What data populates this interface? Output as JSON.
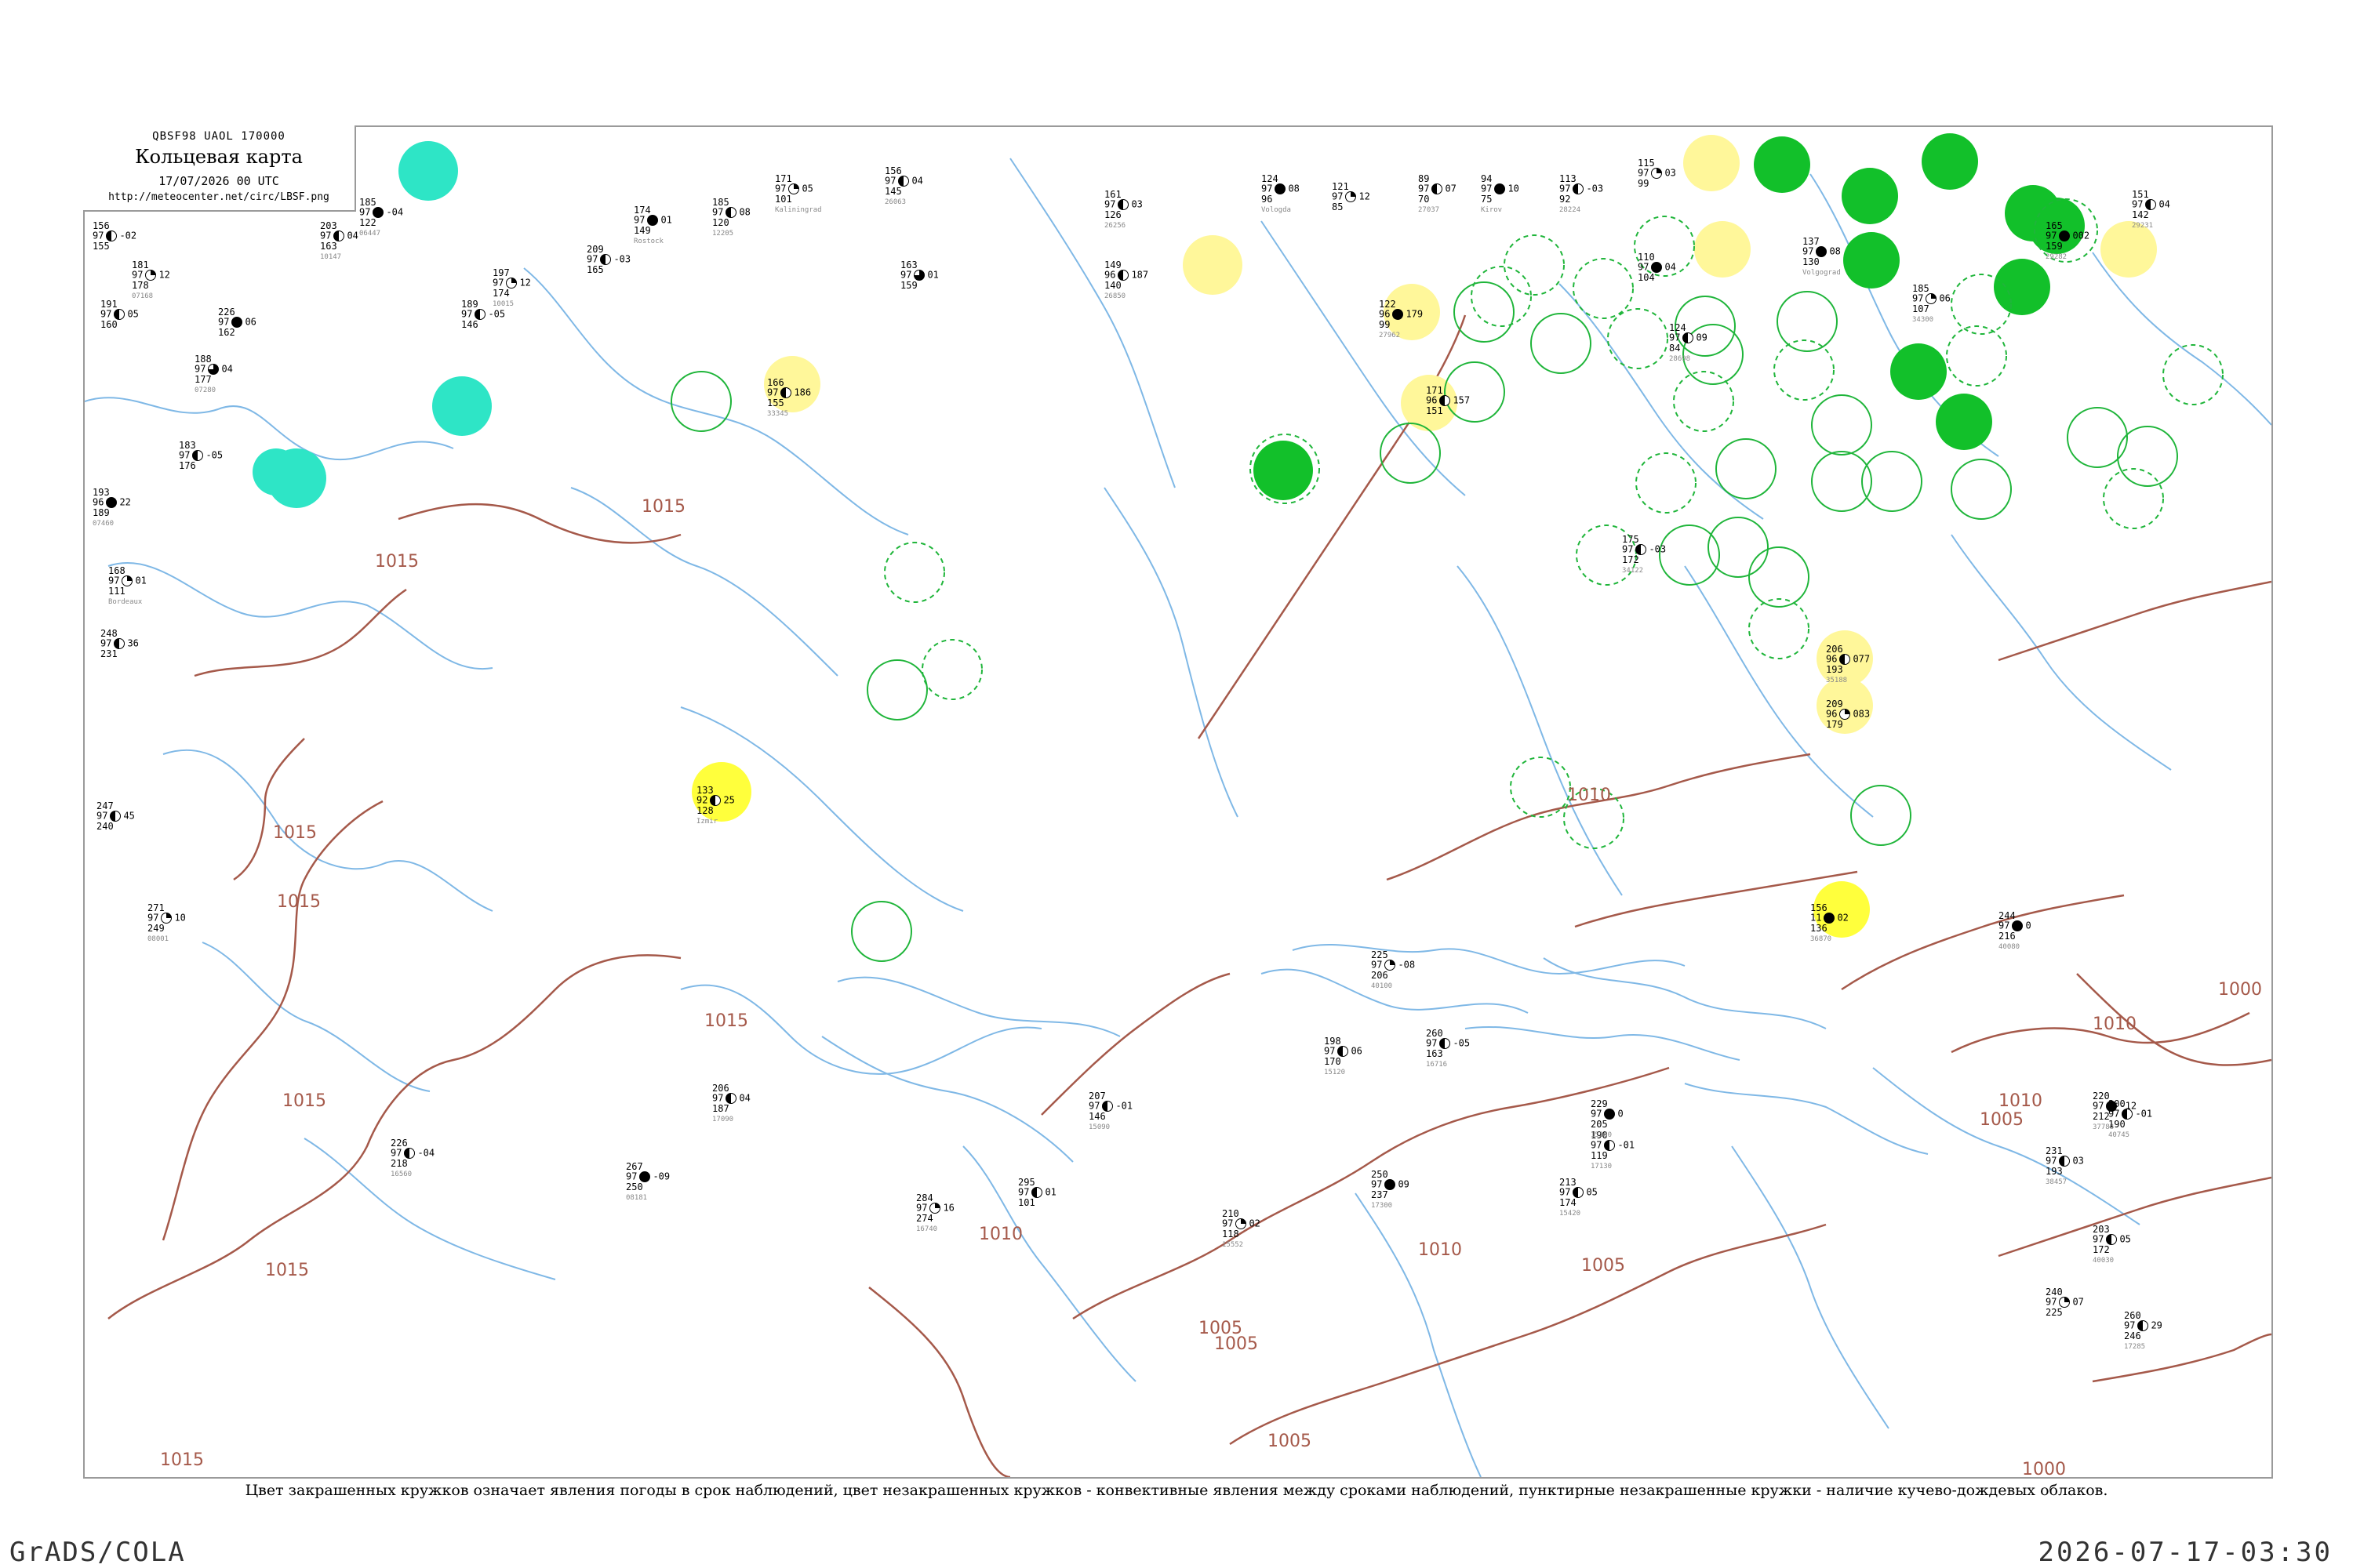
{
  "header": {
    "code": "QBSF98  UAOL  170000",
    "title": "Кольцевая карта",
    "date": "17/07/2026 00 UTC",
    "url": "http://meteocenter.net/circ/LBSF.png"
  },
  "legend_note": "Цвет закрашенных кружков означает явления погоды в срок наблюдений, цвет незакрашенных кружков - конвективные явления между сроками наблюдений, пунктирные незакрашенные кружки - наличие кучево-дождевых облаков.",
  "footer": {
    "left": "GrADS/COLA",
    "right": "2026-07-17-03:30"
  },
  "colors": {
    "isobar": "#a5594a",
    "river": "#7fb8e6",
    "cyan_marker": "#2ee5c6",
    "green_marker": "#12c02a",
    "yellow_marker": "#ffff3c",
    "pale_yellow_marker": "#fff79a",
    "green_ring": "#1fb53a",
    "frame": "#9a9a9a"
  },
  "isobar_labels": [
    "1015",
    "1015",
    "1015",
    "1015",
    "1015",
    "1015",
    "1015",
    "1015",
    "1010",
    "1010",
    "1010",
    "1010",
    "1010",
    "1005",
    "1005",
    "1005",
    "1005",
    "1005",
    "1000",
    "1000"
  ],
  "stations": [
    {
      "top": "156",
      "mid": "97",
      "bot": "155",
      "right": "-02",
      "cover": "half",
      "name": ""
    },
    {
      "top": "181",
      "mid": "97",
      "bot": "178",
      "right": "12",
      "cover": "q",
      "name": "07168"
    },
    {
      "top": "191",
      "mid": "97",
      "bot": "160",
      "right": "05",
      "cover": "half",
      "name": ""
    },
    {
      "top": "226",
      "mid": "97",
      "bot": "162",
      "right": "06",
      "cover": "full",
      "name": ""
    },
    {
      "top": "188",
      "mid": "97",
      "bot": "177",
      "right": "04",
      "cover": "tq",
      "name": "07280"
    },
    {
      "top": "183",
      "mid": "97",
      "bot": "176",
      "right": "-05",
      "cover": "half",
      "name": ""
    },
    {
      "top": "193",
      "mid": "96",
      "bot": "189",
      "right": "22",
      "cover": "full",
      "name": "07460"
    },
    {
      "top": "168",
      "mid": "97",
      "bot": "111",
      "right": "01",
      "cover": "q",
      "name": "Bordeaux"
    },
    {
      "top": "248",
      "mid": "97",
      "bot": "231",
      "right": "36",
      "cover": "half",
      "name": ""
    },
    {
      "top": "247",
      "mid": "97",
      "bot": "240",
      "right": "45",
      "cover": "half",
      "name": ""
    },
    {
      "top": "271",
      "mid": "97",
      "bot": "249",
      "right": "10",
      "cover": "q",
      "name": "08001"
    },
    {
      "top": "185",
      "mid": "97",
      "bot": "122",
      "right": "-04",
      "cover": "full",
      "name": "06447"
    },
    {
      "top": "203",
      "mid": "97",
      "bot": "163",
      "right": "04",
      "cover": "half",
      "name": "10147"
    },
    {
      "top": "189",
      "mid": "97",
      "bot": "146",
      "right": "-05",
      "cover": "half",
      "name": ""
    },
    {
      "top": "197",
      "mid": "97",
      "bot": "174",
      "right": "12",
      "cover": "q",
      "name": "10015"
    },
    {
      "top": "209",
      "mid": "97",
      "bot": "165",
      "right": "-03",
      "cover": "half",
      "name": ""
    },
    {
      "top": "174",
      "mid": "97",
      "bot": "149",
      "right": "01",
      "cover": "full",
      "name": "Rostock"
    },
    {
      "top": "185",
      "mid": "97",
      "bot": "120",
      "right": "08",
      "cover": "half",
      "name": "12205"
    },
    {
      "top": "171",
      "mid": "97",
      "bot": "101",
      "right": "05",
      "cover": "q",
      "name": "Kaliningrad"
    },
    {
      "top": "156",
      "mid": "97",
      "bot": "145",
      "right": "04",
      "cover": "half",
      "name": "26063"
    },
    {
      "top": "163",
      "mid": "97",
      "bot": "159",
      "right": "01",
      "cover": "tq",
      "name": ""
    },
    {
      "top": "161",
      "mid": "97",
      "bot": "126",
      "right": "03",
      "cover": "half",
      "name": "26256"
    },
    {
      "top": "124",
      "mid": "97",
      "bot": "96",
      "right": "08",
      "cover": "full",
      "name": "Vologda"
    },
    {
      "top": "121",
      "mid": "97",
      "bot": "85",
      "right": "12",
      "cover": "q",
      "name": ""
    },
    {
      "top": "89",
      "mid": "97",
      "bot": "70",
      "right": "07",
      "cover": "half",
      "name": "27037"
    },
    {
      "top": "94",
      "mid": "97",
      "bot": "75",
      "right": "10",
      "cover": "full",
      "name": "Kirov"
    },
    {
      "top": "113",
      "mid": "97",
      "bot": "92",
      "right": "-03",
      "cover": "half",
      "name": "28224"
    },
    {
      "top": "115",
      "mid": "97",
      "bot": "99",
      "right": "03",
      "cover": "q",
      "name": ""
    },
    {
      "top": "151",
      "mid": "97",
      "bot": "142",
      "right": "04",
      "cover": "half",
      "name": "29231"
    },
    {
      "top": "165",
      "mid": "97",
      "bot": "159",
      "right": "002",
      "cover": "full",
      "name": "29282"
    },
    {
      "top": "149",
      "mid": "96",
      "bot": "140",
      "right": "187",
      "cover": "half",
      "name": "26850"
    },
    {
      "top": "122",
      "mid": "96",
      "bot": "99",
      "right": "179",
      "cover": "full",
      "name": "27962"
    },
    {
      "top": "171",
      "mid": "96",
      "bot": "151",
      "right": "157",
      "cover": "half",
      "name": ""
    },
    {
      "top": "166",
      "mid": "97",
      "bot": "155",
      "right": "186",
      "cover": "half",
      "name": "33345"
    },
    {
      "top": "133",
      "mid": "92",
      "bot": "128",
      "right": "25",
      "cover": "half",
      "name": "Izmir"
    },
    {
      "top": "156",
      "mid": "11",
      "bot": "136",
      "right": "02",
      "cover": "full",
      "name": "36870"
    },
    {
      "top": "206",
      "mid": "96",
      "bot": "193",
      "right": "077",
      "cover": "half",
      "name": "35188"
    },
    {
      "top": "209",
      "mid": "96",
      "bot": "179",
      "right": "083",
      "cover": "q",
      "name": ""
    },
    {
      "top": "137",
      "mid": "97",
      "bot": "130",
      "right": "08",
      "cover": "full",
      "name": "Volgograd"
    },
    {
      "top": "175",
      "mid": "97",
      "bot": "172",
      "right": "-03",
      "cover": "half",
      "name": "34122"
    },
    {
      "top": "185",
      "mid": "97",
      "bot": "107",
      "right": "06",
      "cover": "q",
      "name": "34300"
    },
    {
      "top": "110",
      "mid": "97",
      "bot": "104",
      "right": "04",
      "cover": "full",
      "name": ""
    },
    {
      "top": "124",
      "mid": "97",
      "bot": "84",
      "right": "09",
      "cover": "half",
      "name": "28698"
    },
    {
      "top": "220",
      "mid": "97",
      "bot": "212",
      "right": "-12",
      "cover": "full",
      "name": "37788"
    },
    {
      "top": "231",
      "mid": "97",
      "bot": "193",
      "right": "03",
      "cover": "half",
      "name": "38457"
    },
    {
      "top": "200",
      "mid": "97",
      "bot": "190",
      "right": "-01",
      "cover": "half",
      "name": "40745"
    },
    {
      "top": "240",
      "mid": "97",
      "bot": "225",
      "right": "07",
      "cover": "q",
      "name": ""
    },
    {
      "top": "250",
      "mid": "97",
      "bot": "237",
      "right": "09",
      "cover": "full",
      "name": "17300"
    },
    {
      "top": "190",
      "mid": "97",
      "bot": "119",
      "right": "-01",
      "cover": "half",
      "name": "17130"
    },
    {
      "top": "260",
      "mid": "97",
      "bot": "163",
      "right": "-05",
      "cover": "half",
      "name": "16716"
    },
    {
      "top": "284",
      "mid": "97",
      "bot": "274",
      "right": "16",
      "cover": "q",
      "name": "16740"
    },
    {
      "top": "295",
      "mid": "97",
      "bot": "101",
      "right": "01",
      "cover": "half",
      "name": ""
    },
    {
      "top": "267",
      "mid": "97",
      "bot": "250",
      "right": "-09",
      "cover": "full",
      "name": "08181"
    },
    {
      "top": "226",
      "mid": "97",
      "bot": "218",
      "right": "-04",
      "cover": "half",
      "name": "16560"
    },
    {
      "top": "206",
      "mid": "97",
      "bot": "187",
      "right": "04",
      "cover": "half",
      "name": "17090"
    },
    {
      "top": "225",
      "mid": "97",
      "bot": "206",
      "right": "-08",
      "cover": "q",
      "name": "40100"
    },
    {
      "top": "244",
      "mid": "97",
      "bot": "216",
      "right": "0",
      "cover": "full",
      "name": "40080"
    },
    {
      "top": "203",
      "mid": "97",
      "bot": "172",
      "right": "05",
      "cover": "half",
      "name": "40030"
    },
    {
      "top": "260",
      "mid": "97",
      "bot": "246",
      "right": "29",
      "cover": "half",
      "name": "17285"
    },
    {
      "top": "210",
      "mid": "97",
      "bot": "118",
      "right": "02",
      "cover": "q",
      "name": "15552"
    },
    {
      "top": "213",
      "mid": "97",
      "bot": "174",
      "right": "05",
      "cover": "half",
      "name": "15420"
    },
    {
      "top": "229",
      "mid": "97",
      "bot": "205",
      "right": "0",
      "cover": "full",
      "name": "15360"
    },
    {
      "top": "198",
      "mid": "97",
      "bot": "170",
      "right": "06",
      "cover": "half",
      "name": "15120"
    },
    {
      "top": "207",
      "mid": "97",
      "bot": "146",
      "right": "-01",
      "cover": "half",
      "name": "15090"
    }
  ]
}
